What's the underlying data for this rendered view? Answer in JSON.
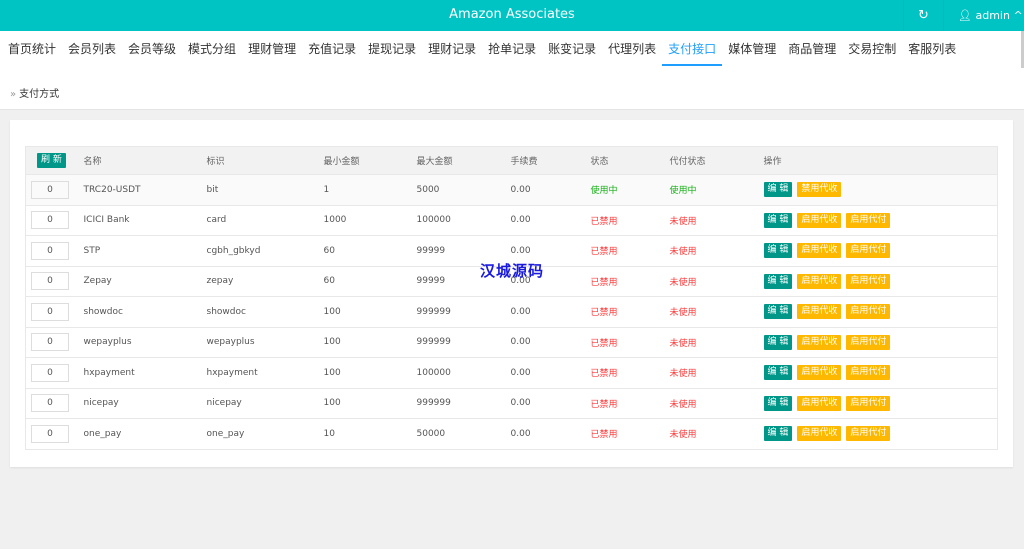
{
  "header": {
    "title": "Amazon Associates",
    "refresh_icon": "refresh-icon",
    "user": "admin"
  },
  "nav": [
    "首页统计",
    "会员列表",
    "会员等级",
    "模式分组",
    "理财管理",
    "充值记录",
    "提现记录",
    "理财记录",
    "抢单记录",
    "账变记录",
    "代理列表",
    "支付接口",
    "媒体管理",
    "商品管理",
    "交易控制",
    "客服列表"
  ],
  "nav_active": "支付接口",
  "breadcrumb": "支付方式",
  "table": {
    "refresh_label": "刷 新",
    "headers": [
      "名称",
      "标识",
      "最小金额",
      "最大金额",
      "手续费",
      "状态",
      "代付状态",
      "操作"
    ],
    "rows": [
      {
        "sort": "0",
        "name": "TRC20-USDT",
        "id": "bit",
        "min": "1",
        "max": "5000",
        "fee": "0.00",
        "status": "使用中",
        "pay_status": "使用中",
        "actions": [
          "编 辑",
          "禁用代收"
        ]
      },
      {
        "sort": "0",
        "name": "ICICI Bank",
        "id": "card",
        "min": "1000",
        "max": "100000",
        "fee": "0.00",
        "status": "已禁用",
        "pay_status": "未使用",
        "actions": [
          "编 辑",
          "启用代收",
          "启用代付"
        ]
      },
      {
        "sort": "0",
        "name": "STP",
        "id": "cgbh_gbkyd",
        "min": "60",
        "max": "99999",
        "fee": "0.00",
        "status": "已禁用",
        "pay_status": "未使用",
        "actions": [
          "编 辑",
          "启用代收",
          "启用代付"
        ]
      },
      {
        "sort": "0",
        "name": "Zepay",
        "id": "zepay",
        "min": "60",
        "max": "99999",
        "fee": "0.00",
        "status": "已禁用",
        "pay_status": "未使用",
        "actions": [
          "编 辑",
          "启用代收",
          "启用代付"
        ]
      },
      {
        "sort": "0",
        "name": "showdoc",
        "id": "showdoc",
        "min": "100",
        "max": "999999",
        "fee": "0.00",
        "status": "已禁用",
        "pay_status": "未使用",
        "actions": [
          "编 辑",
          "启用代收",
          "启用代付"
        ]
      },
      {
        "sort": "0",
        "name": "wepayplus",
        "id": "wepayplus",
        "min": "100",
        "max": "999999",
        "fee": "0.00",
        "status": "已禁用",
        "pay_status": "未使用",
        "actions": [
          "编 辑",
          "启用代收",
          "启用代付"
        ]
      },
      {
        "sort": "0",
        "name": "hxpayment",
        "id": "hxpayment",
        "min": "100",
        "max": "100000",
        "fee": "0.00",
        "status": "已禁用",
        "pay_status": "未使用",
        "actions": [
          "编 辑",
          "启用代收",
          "启用代付"
        ]
      },
      {
        "sort": "0",
        "name": "nicepay",
        "id": "nicepay",
        "min": "100",
        "max": "999999",
        "fee": "0.00",
        "status": "已禁用",
        "pay_status": "未使用",
        "actions": [
          "编 辑",
          "启用代收",
          "启用代付"
        ]
      },
      {
        "sort": "0",
        "name": "one_pay",
        "id": "one_pay",
        "min": "10",
        "max": "50000",
        "fee": "0.00",
        "status": "已禁用",
        "pay_status": "未使用",
        "actions": [
          "编 辑",
          "启用代收",
          "启用代付"
        ]
      }
    ]
  },
  "watermark": "汉城源码",
  "colors": {
    "header": "#00c4c4",
    "active_tab": "#1e9fff",
    "edit": "#009688",
    "toggle": "#ffb800",
    "enabled": "#17b117",
    "disabled": "#ff3a3a"
  }
}
